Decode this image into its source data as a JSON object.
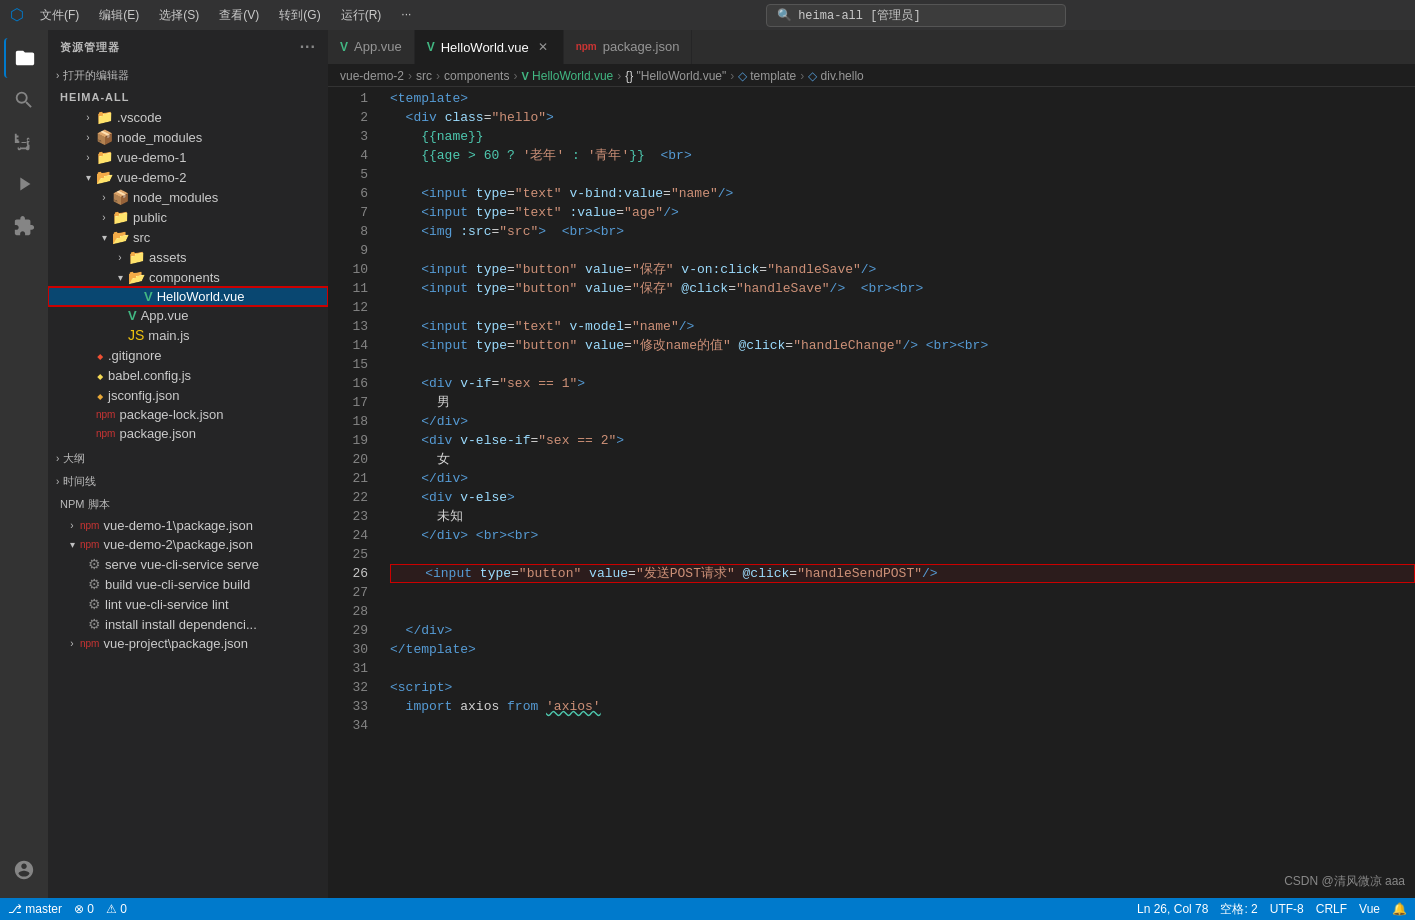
{
  "titlebar": {
    "icon": "✦",
    "menus": [
      "文件(F)",
      "编辑(E)",
      "选择(S)",
      "查看(V)",
      "转到(G)",
      "运行(R)",
      "···"
    ],
    "search_text": "heima-all [管理员]"
  },
  "sidebar": {
    "header": "资源管理器",
    "header_dots": "···",
    "open_editors_label": "打开的编辑器",
    "root_label": "HEIMA-ALL",
    "sections": {
      "outline_label": "大纲",
      "timeline_label": "时间线",
      "npm_label": "NPM 脚本"
    }
  },
  "file_tree": [
    {
      "id": "vscode",
      "label": ".vscode",
      "type": "folder",
      "indent": 2,
      "expanded": false
    },
    {
      "id": "node_modules_root",
      "label": "node_modules",
      "type": "folder-npm",
      "indent": 2,
      "expanded": false
    },
    {
      "id": "vue_demo_1",
      "label": "vue-demo-1",
      "type": "folder",
      "indent": 2,
      "expanded": false
    },
    {
      "id": "vue_demo_2",
      "label": "vue-demo-2",
      "type": "folder-open",
      "indent": 2,
      "expanded": true
    },
    {
      "id": "node_modules_2",
      "label": "node_modules",
      "type": "folder-npm",
      "indent": 4,
      "expanded": false
    },
    {
      "id": "public",
      "label": "public",
      "type": "folder",
      "indent": 4,
      "expanded": false
    },
    {
      "id": "src",
      "label": "src",
      "type": "folder-open",
      "indent": 4,
      "expanded": true
    },
    {
      "id": "assets",
      "label": "assets",
      "type": "folder",
      "indent": 6,
      "expanded": false
    },
    {
      "id": "components",
      "label": "components",
      "type": "folder-open",
      "indent": 6,
      "expanded": true
    },
    {
      "id": "helloworld_vue",
      "label": "HelloWorld.vue",
      "type": "vue",
      "indent": 8,
      "selected": true
    },
    {
      "id": "app_vue_src",
      "label": "App.vue",
      "type": "vue",
      "indent": 6
    },
    {
      "id": "main_js",
      "label": "main.js",
      "type": "js",
      "indent": 6
    },
    {
      "id": "gitignore",
      "label": ".gitignore",
      "type": "git",
      "indent": 2
    },
    {
      "id": "babel_config",
      "label": "babel.config.js",
      "type": "babel",
      "indent": 2
    },
    {
      "id": "jsconfig",
      "label": "jsconfig.json",
      "type": "json",
      "indent": 2
    },
    {
      "id": "package_lock",
      "label": "package-lock.json",
      "type": "npm-json",
      "indent": 2
    },
    {
      "id": "package_json_root",
      "label": "package.json",
      "type": "npm-json",
      "indent": 2
    }
  ],
  "npm_scripts": {
    "vue_demo_1": {
      "label": "vue-demo-1\\package.json",
      "expanded": false
    },
    "vue_demo_2": {
      "label": "vue-demo-2\\package.json",
      "expanded": true,
      "scripts": [
        {
          "name": "serve",
          "cmd": "vue-cli-service serve"
        },
        {
          "name": "build",
          "cmd": "vue-cli-service build"
        },
        {
          "name": "lint",
          "cmd": "vue-cli-service lint"
        },
        {
          "name": "install",
          "cmd": "install dependenci..."
        }
      ]
    },
    "vue_project": {
      "label": "vue-project\\package.json",
      "expanded": false
    }
  },
  "tabs": [
    {
      "id": "app_vue",
      "label": "App.vue",
      "type": "vue",
      "active": false
    },
    {
      "id": "helloworld_vue",
      "label": "HelloWorld.vue",
      "type": "vue",
      "active": true,
      "closeable": true
    },
    {
      "id": "package_json",
      "label": "package.json",
      "type": "json",
      "active": false
    }
  ],
  "breadcrumb": {
    "parts": [
      "vue-demo-2",
      "src",
      "components",
      "HelloWorld.vue",
      "HelloWorld.vue",
      "template",
      "div.hello"
    ]
  },
  "code": {
    "lines": [
      {
        "num": 1,
        "content": "<template>",
        "highlight": false
      },
      {
        "num": 2,
        "content": "  <div class=\"hello\">",
        "highlight": false
      },
      {
        "num": 3,
        "content": "    {{name}}",
        "highlight": false
      },
      {
        "num": 4,
        "content": "    {{age > 60 ? '老年' : '青年'}}  <br>",
        "highlight": false
      },
      {
        "num": 5,
        "content": "",
        "highlight": false
      },
      {
        "num": 6,
        "content": "    <input type=\"text\" v-bind:value=\"name\"/>",
        "highlight": false
      },
      {
        "num": 7,
        "content": "    <input type=\"text\" :value=\"age\"/>",
        "highlight": false
      },
      {
        "num": 8,
        "content": "    <img :src=\"src\">  <br><br>",
        "highlight": false
      },
      {
        "num": 9,
        "content": "",
        "highlight": false
      },
      {
        "num": 10,
        "content": "    <input type=\"button\" value=\"保存\" v-on:click=\"handleSave\"/>",
        "highlight": false
      },
      {
        "num": 11,
        "content": "    <input type=\"button\" value=\"保存\" @click=\"handleSave\"/>  <br><br>",
        "highlight": false
      },
      {
        "num": 12,
        "content": "",
        "highlight": false
      },
      {
        "num": 13,
        "content": "    <input type=\"text\" v-model=\"name\"/>",
        "highlight": false
      },
      {
        "num": 14,
        "content": "    <input type=\"button\" value=\"修改name的值\" @click=\"handleChange\"/> <br><br>",
        "highlight": false
      },
      {
        "num": 15,
        "content": "",
        "highlight": false
      },
      {
        "num": 16,
        "content": "    <div v-if=\"sex == 1\">",
        "highlight": false
      },
      {
        "num": 17,
        "content": "      男",
        "highlight": false
      },
      {
        "num": 18,
        "content": "    </div>",
        "highlight": false
      },
      {
        "num": 19,
        "content": "    <div v-else-if=\"sex == 2\">",
        "highlight": false
      },
      {
        "num": 20,
        "content": "      女",
        "highlight": false
      },
      {
        "num": 21,
        "content": "    </div>",
        "highlight": false
      },
      {
        "num": 22,
        "content": "    <div v-else>",
        "highlight": false
      },
      {
        "num": 23,
        "content": "      未知",
        "highlight": false
      },
      {
        "num": 24,
        "content": "    </div> <br><br>",
        "highlight": false
      },
      {
        "num": 25,
        "content": "",
        "highlight": false
      },
      {
        "num": 26,
        "content": "    <input type=\"button\" value=\"发送POST请求\" @click=\"handleSendPOST\"/>",
        "highlight": true
      },
      {
        "num": 27,
        "content": "",
        "highlight": false
      },
      {
        "num": 28,
        "content": "",
        "highlight": false
      },
      {
        "num": 29,
        "content": "  </div>",
        "highlight": false
      },
      {
        "num": 30,
        "content": "</template>",
        "highlight": false
      },
      {
        "num": 31,
        "content": "",
        "highlight": false
      },
      {
        "num": 32,
        "content": "<script>",
        "highlight": false
      },
      {
        "num": 33,
        "content": "  import axios from 'axios'",
        "highlight": false
      },
      {
        "num": 34,
        "content": "",
        "highlight": false
      }
    ]
  },
  "status_bar": {
    "git_branch": "⎇ master",
    "errors": "⊗ 0",
    "warnings": "⚠ 0",
    "ln_col": "Ln 26, Col 78",
    "spaces": "空格: 2",
    "encoding": "UTF-8",
    "line_ending": "CRLF",
    "language": "Vue",
    "feedback": "🔔",
    "watermark": "CSDN @清风微凉 aaa"
  }
}
